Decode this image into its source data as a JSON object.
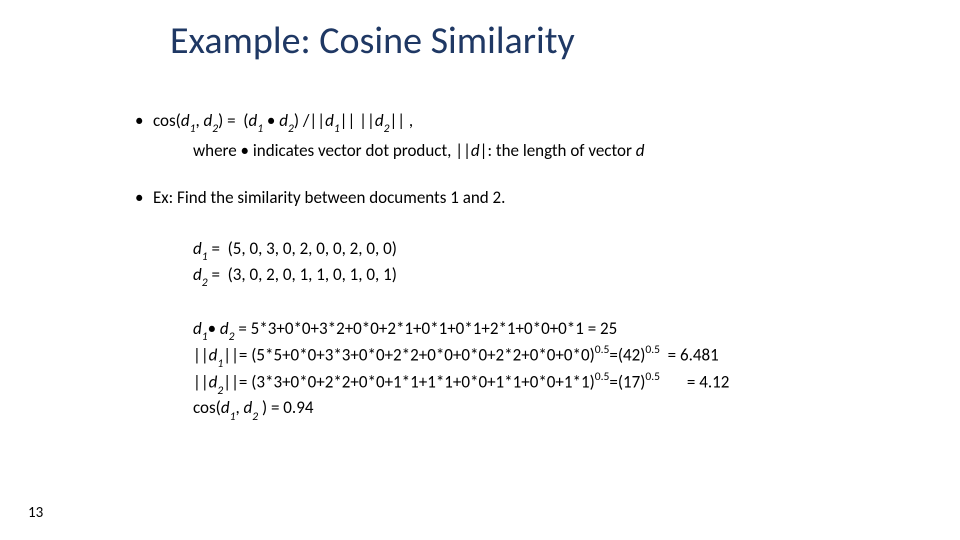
{
  "title": "Example: Cosine Similarity",
  "formula_line": "cos(d₁, d₂) = (d₁ • d₂) / ||d₁|| ||d₂|| ,",
  "formula_where": "where • indicates vector dot product, ||d|: the length of vector d",
  "ex_line": "Ex: Find the similarity between documents 1 and 2.",
  "d1_vec": "d₁ =  (5, 0, 3, 0, 2, 0, 0, 2, 0, 0)",
  "d2_vec": "d₂ =  (3, 0, 2, 0, 1, 1, 0, 1, 0, 1)",
  "dot_line": "d₁• d₂ = 5*3+0*0+3*2+0*0+2*1+0*1+0*1+2*1+0*0+0*1 = 25",
  "norm1_line": "||d₁||= (5*5+0*0+3*3+0*0+2*2+0*0+0*0+2*2+0*0+0*0)^0.5 =(42)^0.5  = 6.481",
  "norm2_line": "||d₂||= (3*3+0*0+2*2+0*0+1*1+1*1+0*0+1*1+0*0+1*1)^0.5 =(17)^0.5       = 4.12",
  "cos_line": "cos(d₁, d₂ ) = 0.94",
  "page_number": "13"
}
